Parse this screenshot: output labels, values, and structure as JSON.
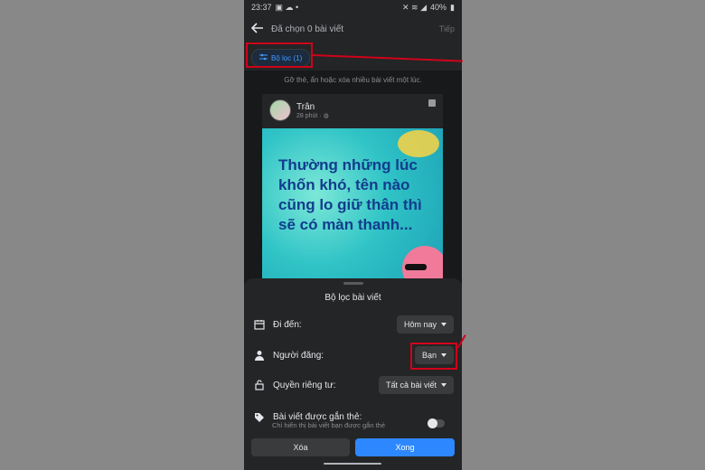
{
  "status_bar": {
    "time": "23:37",
    "battery": "40%"
  },
  "app_bar": {
    "title": "Đã chọn 0 bài viết",
    "next_label": "Tiếp"
  },
  "filter_chip": {
    "label": "Bộ lọc (1)"
  },
  "hint": "Gỡ thẻ, ẩn hoặc xóa nhiều bài viết một lúc.",
  "post": {
    "author": "Trân",
    "time": "28 phút · ",
    "image_text": "Thường những lúc khốn khó, tên nào cũng lo giữ thân thì sẽ có màn thanh..."
  },
  "filter_sheet": {
    "title": "Bộ lọc bài viết",
    "rows": [
      {
        "label": "Đi đến:",
        "value": "Hôm nay",
        "icon": "calendar-icon"
      },
      {
        "label": "Người đăng:",
        "value": "Bạn",
        "icon": "person-icon"
      },
      {
        "label": "Quyền riêng tư:",
        "value": "Tất cả bài viết",
        "icon": "unlock-icon"
      }
    ],
    "tagged": {
      "label": "Bài viết được gắn thẻ:",
      "sublabel": "Chỉ hiển thị bài viết bạn được gắn thẻ",
      "enabled": false
    },
    "delete_label": "Xóa",
    "done_label": "Xong"
  },
  "colors": {
    "accent": "#2d88ff",
    "highlight": "#d0021b",
    "background": "#18191a"
  }
}
